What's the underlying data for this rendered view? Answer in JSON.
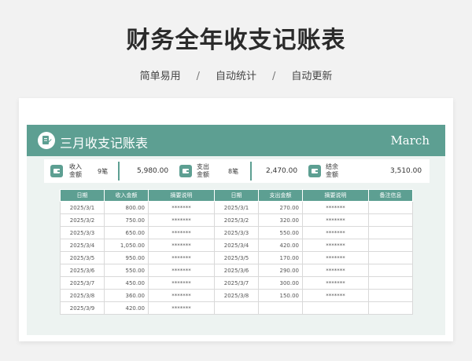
{
  "header": {
    "title": "财务全年收支记账表",
    "features": [
      "简单易用",
      "自动统计",
      "自动更新"
    ],
    "separator": "/"
  },
  "banner": {
    "title": "三月收支记账表",
    "month": "March"
  },
  "summary": {
    "income": {
      "label_line1": "收入",
      "label_line2": "金额",
      "count": "9笔",
      "amount": "5,980.00"
    },
    "expense": {
      "label_line1": "支出",
      "label_line2": "金额",
      "count": "8笔",
      "amount": "2,470.00"
    },
    "balance": {
      "label_line1": "结余",
      "label_line2": "金额",
      "amount": "3,510.00"
    }
  },
  "table": {
    "headers": [
      "日期",
      "收入金额",
      "摘要说明",
      "日期",
      "支出金额",
      "摘要说明",
      "备注信息"
    ],
    "rows": [
      [
        "2025/3/1",
        "800.00",
        "*******",
        "2025/3/1",
        "270.00",
        "*******",
        ""
      ],
      [
        "2025/3/2",
        "750.00",
        "*******",
        "2025/3/2",
        "320.00",
        "*******",
        ""
      ],
      [
        "2025/3/3",
        "650.00",
        "*******",
        "2025/3/3",
        "550.00",
        "*******",
        ""
      ],
      [
        "2025/3/4",
        "1,050.00",
        "*******",
        "2025/3/4",
        "420.00",
        "*******",
        ""
      ],
      [
        "2025/3/5",
        "950.00",
        "*******",
        "2025/3/5",
        "170.00",
        "*******",
        ""
      ],
      [
        "2025/3/6",
        "550.00",
        "*******",
        "2025/3/6",
        "290.00",
        "*******",
        ""
      ],
      [
        "2025/3/7",
        "450.00",
        "*******",
        "2025/3/7",
        "300.00",
        "*******",
        ""
      ],
      [
        "2025/3/8",
        "360.00",
        "*******",
        "2025/3/8",
        "150.00",
        "*******",
        ""
      ],
      [
        "2025/3/9",
        "420.00",
        "*******",
        "",
        "",
        "",
        ""
      ]
    ]
  },
  "colors": {
    "accent": "#5d9f92"
  }
}
